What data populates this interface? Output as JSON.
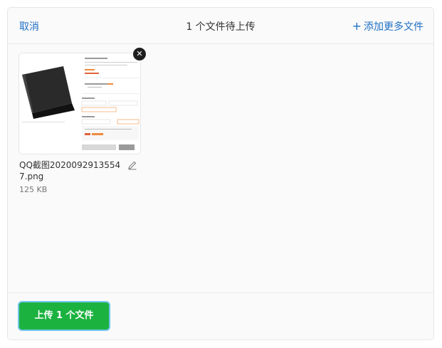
{
  "header": {
    "cancel_label": "取消",
    "title": "1 个文件待上传",
    "add_more_label": "添加更多文件"
  },
  "file": {
    "name": "QQ截图20200929135547.png",
    "size": "125 KB"
  },
  "footer": {
    "upload_label": "上传 1 个文件"
  },
  "colors": {
    "accent": "#1f6fc5",
    "upload_button": "#1bb240"
  },
  "icons": [
    "plus-icon",
    "close-icon",
    "edit-pencil-icon"
  ]
}
